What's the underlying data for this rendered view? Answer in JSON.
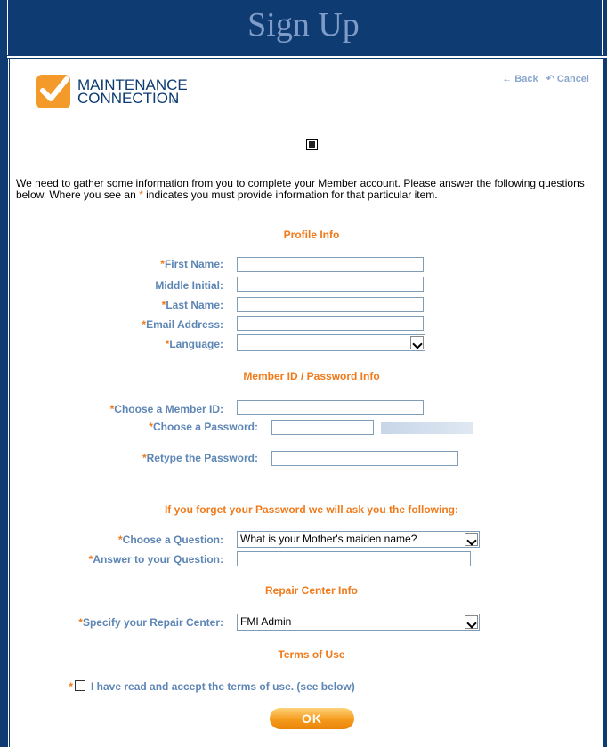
{
  "header": {
    "title": "Sign Up"
  },
  "logo": {
    "line1": "MAINTENANCE",
    "line2": "CONNECTION",
    "registered": "®"
  },
  "nav": {
    "back_label": "← Back",
    "cancel_label": "↶ Cancel"
  },
  "intro": {
    "before_star": "We need to gather some information from you to complete your Member account. Please answer the following questions below. Where you see an ",
    "star": "*",
    "after_star": " indicates you must provide information for that particular item."
  },
  "sections": {
    "profile": "Profile Info",
    "member": "Member ID / Password Info",
    "forgot": "If you forget your Password we will ask you the following:",
    "repair": "Repair Center Info",
    "terms": "Terms of Use"
  },
  "fields": {
    "first_name": {
      "req": "*",
      "label": "First Name:"
    },
    "middle_initial": {
      "req": "",
      "label": "Middle Initial:"
    },
    "last_name": {
      "req": "*",
      "label": "Last Name:"
    },
    "email": {
      "req": "*",
      "label": "Email Address:"
    },
    "language": {
      "req": "*",
      "label": "Language:",
      "value": ""
    },
    "member_id": {
      "req": "*",
      "label": "Choose a Member ID:"
    },
    "password": {
      "req": "*",
      "label": "Choose a Password:"
    },
    "retype": {
      "req": "*",
      "label": "Retype the Password:"
    },
    "question": {
      "req": "*",
      "label": "Choose a Question:",
      "value": "What is your Mother's maiden name?"
    },
    "answer": {
      "req": "*",
      "label": "Answer to your Question:"
    },
    "repair_center": {
      "req": "*",
      "label": "Specify your Repair Center:",
      "value": "FMI Admin"
    }
  },
  "terms": {
    "req": "*",
    "label": "I have read and accept the terms of use. (see below)"
  },
  "buttons": {
    "ok_label": "OK"
  },
  "colors": {
    "header_bg": "#0d3b72",
    "accent_orange": "#f07a1a",
    "label_blue": "#5e86b5",
    "title_blue": "#7f9cc8"
  }
}
